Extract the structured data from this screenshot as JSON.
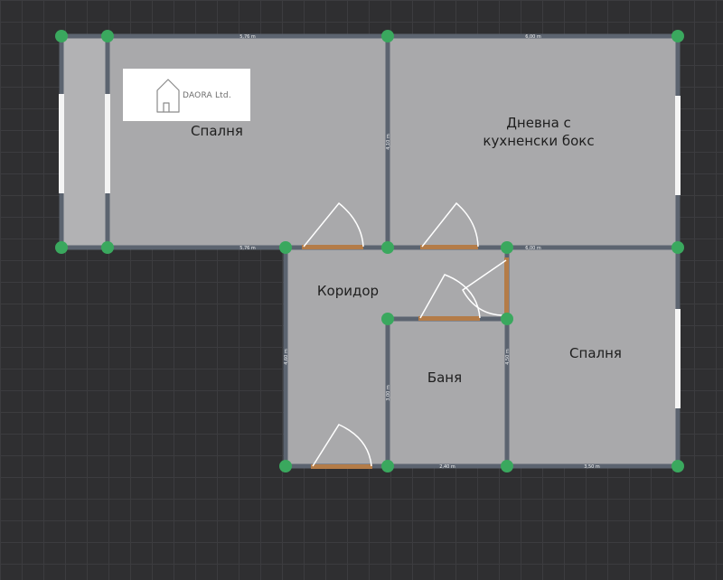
{
  "logo": {
    "text": "DAORA Ltd."
  },
  "rooms": [
    {
      "id": "bedroom-north",
      "lines": [
        "Спалня"
      ]
    },
    {
      "id": "living-kitchen",
      "lines": [
        "Дневна с",
        "кухненски бокс"
      ]
    },
    {
      "id": "corridor",
      "lines": [
        "Коридор"
      ]
    },
    {
      "id": "bathroom",
      "lines": [
        "Баня"
      ]
    },
    {
      "id": "bedroom-south",
      "lines": [
        "Спалня"
      ]
    }
  ],
  "dimensions": {
    "top_left": "5,76 m",
    "top_right": "6,00 m",
    "mid_left": "5,76 m",
    "mid_right": "6,00 m",
    "inner_wall_top": "4,10 m",
    "corridor_height": "4,60 m",
    "bath_left": "3,00 m",
    "bath_right": "4,50 m",
    "bottom_bath": "2,40 m",
    "bottom_bedroom": "3,50 m"
  },
  "colors": {
    "floor": "#a9a9ab",
    "wall": "#5c6470",
    "door": "#b47c48",
    "node": "#3aa85e",
    "window": "#f4f4f4"
  }
}
